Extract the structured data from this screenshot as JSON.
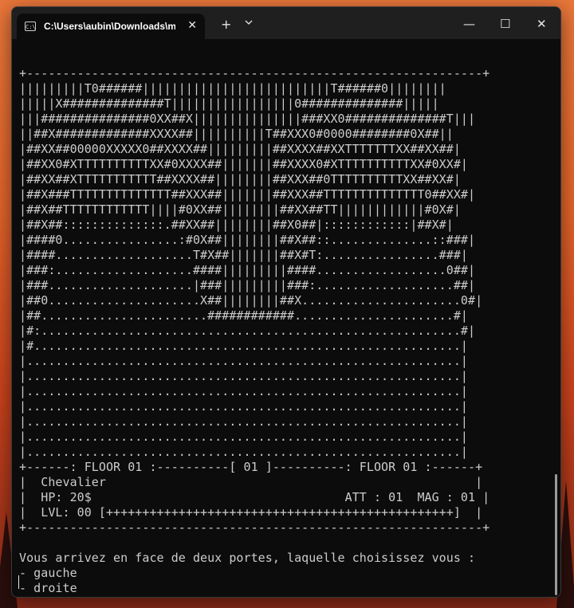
{
  "window": {
    "tab_title": "C:\\Users\\aubin\\Downloads\\m",
    "icons": {
      "tab": "terminal-icon",
      "close_tab": "close-icon",
      "new_tab": "plus-icon",
      "dropdown": "chevron-down-icon",
      "minimize": "minimize-icon",
      "maximize": "maximize-icon",
      "close": "close-icon"
    },
    "glyphs": {
      "close_tab": "✕",
      "new_tab": "+",
      "minimize": "—",
      "maximize": "☐",
      "close": "✕",
      "tab_icon": "C:\\"
    }
  },
  "terminal": {
    "lines": [
      "+---------------------------------------------------------------+",
      "|||||||||T0######||||||||||||||||||||||||||T######0||||||||",
      "|||||X##############T|||||||||||||||||0##############|||||",
      "|||###############0XX##X|||||||||||||||###XX0##############T|||",
      "||##X#############XXXX##||||||||||T##XXX0#0000########0X##||",
      "|##XX##00000XXXXX0##XXXX##|||||||||##XXXX##XXTTTTTTTXX##XX##|",
      "|##XX0#XTTTTTTTTTTXX#0XXXX##|||||||##XXXX0#XTTTTTTTTTTXX#0XX#|",
      "|##XX##XTTTTTTTTTTT##XXXX##||||||||##XXX##0TTTTTTTTTTXX##XX#|",
      "|##X###TTTTTTTTTTTTTT##XXX##|||||||##XXX##TTTTTTTTTTTTTT0##XX#|",
      "|##X##TTTTTTTTTTTT||||#0XX##||||||||##XX##TT||||||||||||#0X#|",
      "|##X##::::::::::::::.##XX##||||||||##X0##|::::::::::::|##X#|",
      "|####0................:#0X##||||||||##X##::..............::###|",
      "|####...................T#X##|||||||##X#T:................###|",
      "|###:...................####|||||||||####..................0##|",
      "|###....................|###|||||||||###:...................##|",
      "|##0.....................X##||||||||##X......................0#|",
      "|##.......................############......................#|",
      "|#:..........................................................#|",
      "|#...........................................................|",
      "|............................................................|",
      "|............................................................|",
      "|............................................................|",
      "|............................................................|",
      "|............................................................|",
      "|............................................................|",
      "|............................................................|",
      "+------: FLOOR 01 :----------[ 01 ]----------: FLOOR 01 :------+",
      "|  Chevalier                                                   |",
      "|  HP: 20$                                   ATT : 01  MAG : 01 |",
      "|  LVL: 00 [++++++++++++++++++++++++++++++++++++++++++++++++]  |",
      "+---------------------------------------------------------------+",
      "",
      "Vous arrivez en face de deux portes, laquelle choisissez vous :",
      "- gauche",
      "- droite"
    ]
  }
}
